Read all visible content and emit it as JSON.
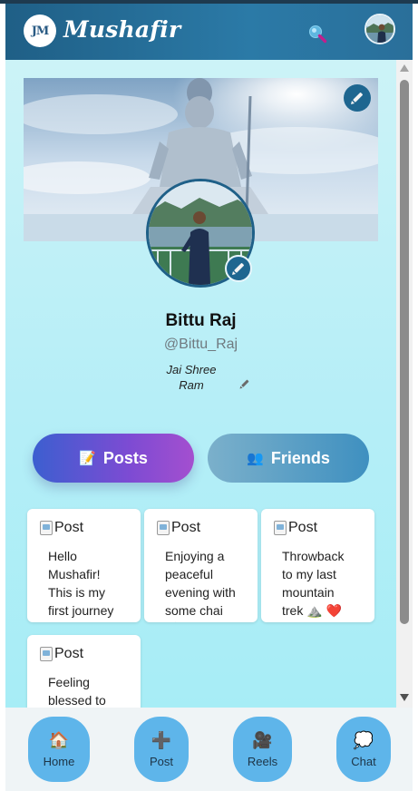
{
  "header": {
    "logo_text": "JM",
    "app_title": "Mushafir",
    "search_icon": "search-icon",
    "avatar_icon": "profile-avatar"
  },
  "profile": {
    "name": "Bittu Raj",
    "handle": "@Bittu_Raj",
    "bio": "Jai Shree Ram"
  },
  "tabs": [
    {
      "label": "Posts",
      "icon": "📝",
      "active": true
    },
    {
      "label": "Friends",
      "icon": "👥",
      "active": false
    }
  ],
  "posts": [
    {
      "image_alt": "Post",
      "caption": "Hello Mushafir! This is my first journey 🚗"
    },
    {
      "image_alt": "Post",
      "caption": "Enjoying a peaceful evening with some chai ☕"
    },
    {
      "image_alt": "Post",
      "caption": "Throwback to my last mountain trek ⛰️ ❤️"
    },
    {
      "image_alt": "Post",
      "caption": "Feeling blessed to"
    }
  ],
  "bottom_nav": [
    {
      "label": "Home",
      "icon": "🏠"
    },
    {
      "label": "Post",
      "icon": "➕"
    },
    {
      "label": "Reels",
      "icon": "🎥"
    },
    {
      "label": "Chat",
      "icon": "💭"
    }
  ],
  "colors": {
    "header": "#2b7aa7",
    "accent_posts": "#7d4bd3",
    "accent_friends": "#3f90c0",
    "nav_button": "#5eb5ea",
    "background": "#b5eef7"
  }
}
